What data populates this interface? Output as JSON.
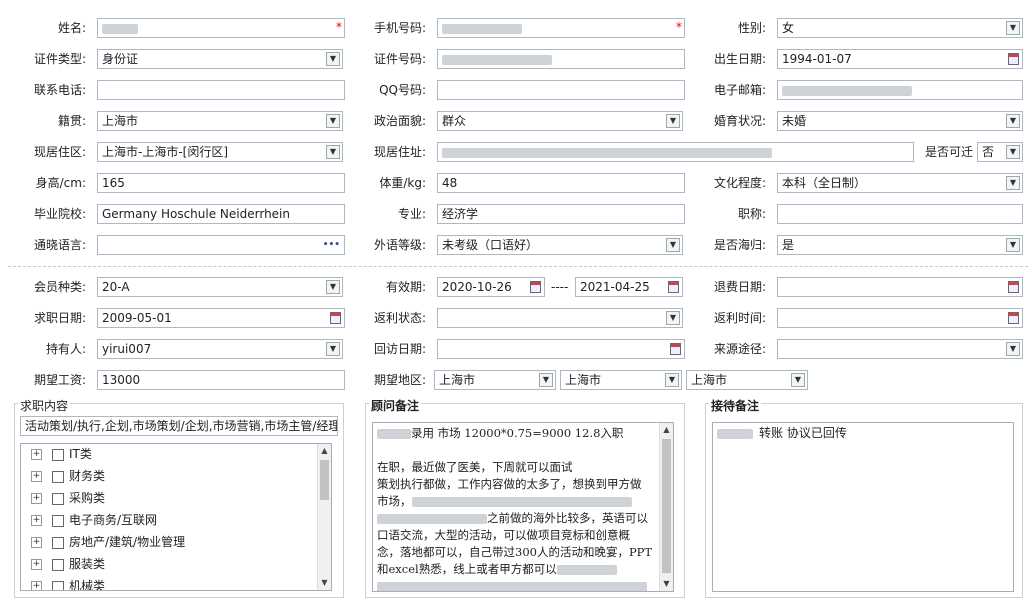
{
  "form": {
    "row1": {
      "name_label": "姓名:",
      "mobile_label": "手机号码:",
      "gender_label": "性别:",
      "gender_value": "女",
      "required_mark": "*"
    },
    "row2": {
      "idtype_label": "证件类型:",
      "idtype_value": "身份证",
      "idno_label": "证件号码:",
      "birth_label": "出生日期:",
      "birth_value": "1994-01-07"
    },
    "row3": {
      "phone_label": "联系电话:",
      "qq_label": "QQ号码:",
      "email_label": "电子邮箱:"
    },
    "row4": {
      "origin_label": "籍贯:",
      "origin_value": "上海市",
      "political_label": "政治面貌:",
      "political_value": "群众",
      "marital_label": "婚育状况:",
      "marital_value": "未婚"
    },
    "row5": {
      "area_label": "现居住区:",
      "area_value": "上海市-上海市-[闵行区]",
      "addr_label": "现居住址:",
      "relocate_label": "是否可迁",
      "relocate_value": "否"
    },
    "row6": {
      "height_label": "身高/cm:",
      "height_value": "165",
      "weight_label": "体重/kg:",
      "weight_value": "48",
      "edu_label": "文化程度:",
      "edu_value": "本科（全日制）"
    },
    "row7": {
      "school_label": "毕业院校:",
      "school_value": "Germany Hoschule Neiderrhein",
      "major_label": "专业:",
      "major_value": "经济学",
      "title_label": "职称:"
    },
    "row8": {
      "lang_label": "通晓语言:",
      "lang_more": "•••",
      "foreign_label": "外语等级:",
      "foreign_value": "未考级（口语好）",
      "returnee_label": "是否海归:",
      "returnee_value": "是"
    }
  },
  "membership": {
    "type_label": "会员种类:",
    "type_value": "20-A",
    "valid_label": "有效期:",
    "valid_from": "2020-10-26",
    "valid_sep": "----",
    "valid_to": "2021-04-25",
    "retire_label": "退费日期:",
    "apply_label": "求职日期:",
    "apply_value": "2009-05-01",
    "rebate_status_label": "返利状态:",
    "rebate_time_label": "返利时间:",
    "holder_label": "持有人:",
    "holder_value": "yirui007",
    "visit_label": "回访日期:",
    "source_label": "来源途径:",
    "salary_label": "期望工资:",
    "salary_value": "13000",
    "region_label": "期望地区:",
    "region1": "上海市",
    "region2": "上海市",
    "region3": "上海市"
  },
  "job_panel": {
    "title": "求职内容",
    "selected": "活动策划/执行,企划,市场策划/企划,市场营销,市场主管/经理",
    "items": [
      "IT类",
      "财务类",
      "采购类",
      "电子商务/互联网",
      "房地产/建筑/物业管理",
      "服装类",
      "机械类"
    ]
  },
  "advisor_panel": {
    "title": "顾问备注",
    "line1_suffix": "录用   市场 12000*0.75=9000   12.8入职",
    "line2": "在职，最近做了医美，下周就可以面试",
    "line3": "策划执行都做，工作内容做的太多了，想换到甲方做",
    "line4_prefix": "市场，",
    "line5_suffix": "之前做的海外比较多，英语可以",
    "line6": "口语交流，大型的活动，可以做项目竞标和创意概",
    "line7": "念，落地都可以，自己带过300人的活动和晚宴，PPT",
    "line8_prefix": "和excel熟悉，线上或者甲方都可以"
  },
  "reception_panel": {
    "title": "接待备注",
    "note_suffix": "转账  协议已回传"
  }
}
